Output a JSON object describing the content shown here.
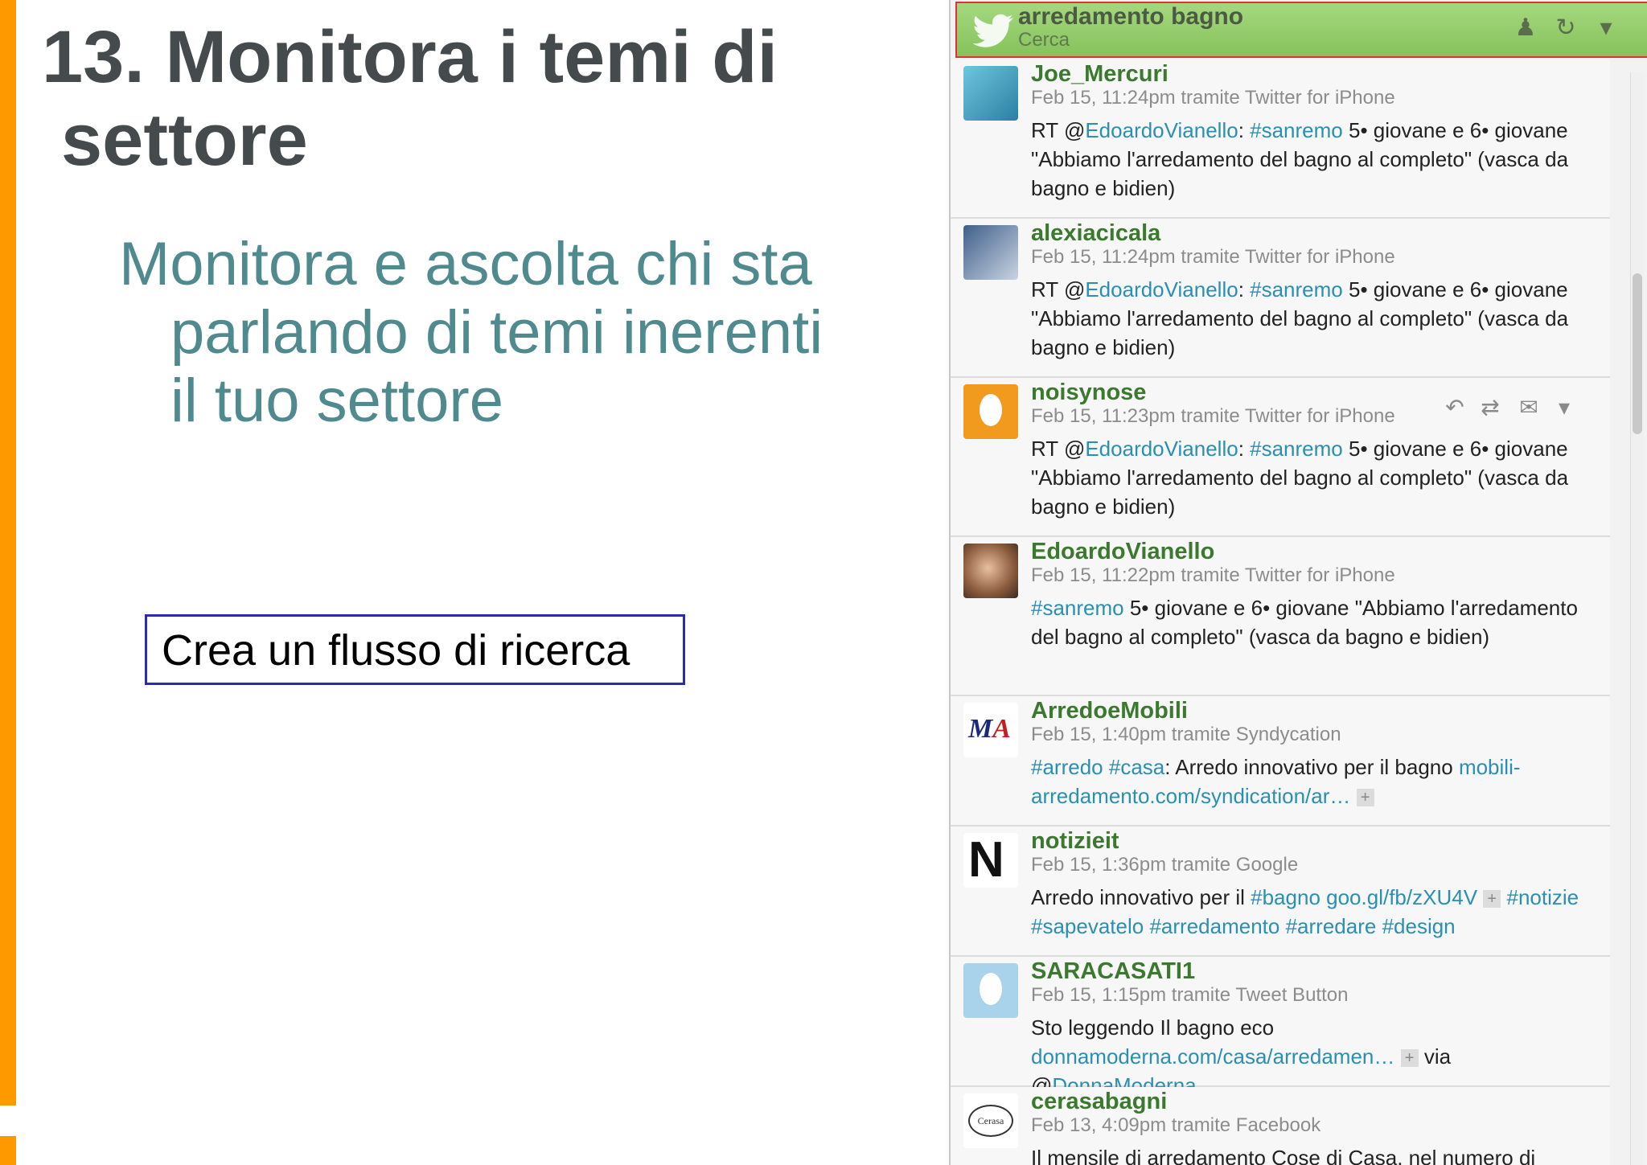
{
  "slide": {
    "title_line1": "13. Monitora i temi di",
    "title_line2": "settore",
    "subtitle_line1": "Monitora e ascolta chi sta",
    "subtitle_line2": "parlando di temi inerenti",
    "subtitle_line3": "il tuo settore",
    "callout": "Crea un flusso di ricerca"
  },
  "stream": {
    "title": "arredamento bagno",
    "subtitle": "Cerca",
    "icons": [
      "user-icon",
      "refresh-icon",
      "dropdown-icon"
    ],
    "tweets": [
      {
        "author": "Joe_Mercuri",
        "meta": "Feb 15, 11:24pm tramite Twitter for iPhone",
        "text": "RT @EdoardoVianello: #sanremo 5• giovane e 6• giovane \"Abbiamo l'arredamento del bagno al completo\" (vasca da bagno e bidien)"
      },
      {
        "author": "alexiacicala",
        "meta": "Feb 15, 11:24pm tramite Twitter for iPhone",
        "text": "RT @EdoardoVianello: #sanremo 5• giovane e 6• giovane \"Abbiamo l'arredamento del bagno al completo\" (vasca da bagno e bidien)"
      },
      {
        "author": "noisynose",
        "meta": "Feb 15, 11:23pm tramite Twitter for iPhone",
        "text": "RT @EdoardoVianello: #sanremo 5• giovane e 6• giovane \"Abbiamo l'arredamento del bagno al completo\" (vasca da bagno e bidien)"
      },
      {
        "author": "EdoardoVianello",
        "meta": "Feb 15, 11:22pm tramite Twitter for iPhone",
        "text": "#sanremo 5• giovane e 6• giovane \"Abbiamo l'arredamento del bagno al completo\" (vasca da bagno e bidien)"
      },
      {
        "author": "ArredoeMobili",
        "meta": "Feb 15, 1:40pm tramite Syndycation",
        "text": "#arredo #casa: Arredo innovativo per il bagno mobili-arredamento.com/syndication/ar…"
      },
      {
        "author": "notizieit",
        "meta": "Feb 15, 1:36pm tramite Google",
        "text": "Arredo innovativo per il #bagno goo.gl/fb/zXU4V #notizie #sapevatelo #arredamento #arredare #design"
      },
      {
        "author": "SARACASATI1",
        "meta": "Feb 15, 1:15pm tramite Tweet Button",
        "text": "Sto leggendo Il bagno eco donnamoderna.com/casa/arredamen… via @DonnaModerna"
      },
      {
        "author": "cerasabagni",
        "meta": "Feb 13, 4:09pm tramite Facebook",
        "text": "Il mensile di arredamento Cose di Casa, nel numero di"
      }
    ]
  },
  "colors": {
    "accent_stripe": "#ff9900",
    "title": "#454a4d",
    "subtitle": "#4f8a8e",
    "callout_border": "#2a2ab5",
    "stream_header": "#86c25c",
    "stream_header_border": "#e0313a",
    "author": "#3b7a2e",
    "link": "#2a8fb3"
  }
}
